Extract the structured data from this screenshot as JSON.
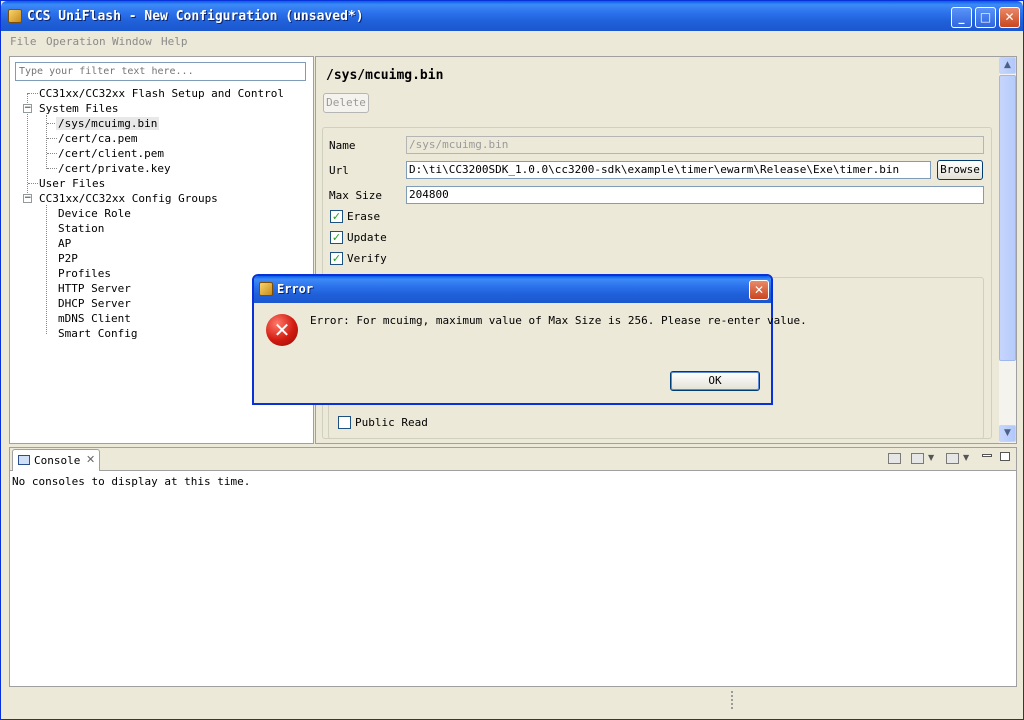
{
  "window": {
    "title": "CCS UniFlash - New Configuration (unsaved*)",
    "controls": {
      "minimize": "_",
      "maximize": "□",
      "close": "✕"
    }
  },
  "menu": [
    "File",
    "Operation",
    "Window",
    "Help"
  ],
  "filter": {
    "placeholder": "Type your filter text here..."
  },
  "tree": {
    "root": "CC31xx/CC32xx Flash Setup and Control",
    "system_files": "System Files",
    "files": [
      "/sys/mcuimg.bin",
      "/cert/ca.pem",
      "/cert/client.pem",
      "/cert/private.key"
    ],
    "user_files": "User Files",
    "config_groups": "CC31xx/CC32xx Config Groups",
    "groups": [
      "Device Role",
      "Station",
      "AP",
      "P2P",
      "Profiles",
      "HTTP Server",
      "DHCP Server",
      "mDNS Client",
      "Smart Config"
    ],
    "expander_collapse": "−"
  },
  "editor": {
    "title": "/sys/mcuimg.bin",
    "delete_label": "Delete",
    "name_label": "Name",
    "name_value": "/sys/mcuimg.bin",
    "url_label": "Url",
    "url_value": "D:\\ti\\CC3200SDK_1.0.0\\cc3200-sdk\\example\\timer\\ewarm\\Release\\Exe\\timer.bin",
    "browse_label": "Browse",
    "maxsize_label": "Max Size",
    "maxsize_value": "204800",
    "checkboxes": [
      {
        "label": "Erase",
        "checked": true
      },
      {
        "label": "Update",
        "checked": true
      },
      {
        "label": "Verify",
        "checked": true
      }
    ],
    "public_read_label": "Public Read",
    "check_mark": "✓",
    "scroll_up": "▲",
    "scroll_down": "▼"
  },
  "console": {
    "tab_label": "Console",
    "tab_close": "✕",
    "message": "No consoles to display at this time."
  },
  "dialog": {
    "title": "Error",
    "close": "✕",
    "icon_glyph": "✕",
    "message": "Error: For mcuimg, maximum value of Max Size is 256. Please re-enter value.",
    "ok_label": "OK"
  }
}
